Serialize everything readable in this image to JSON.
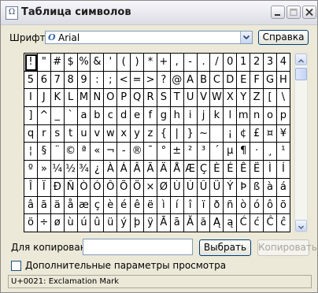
{
  "window": {
    "title": "Таблица символов"
  },
  "font_row": {
    "label": "Шрифт:",
    "selected_font": "Arial",
    "font_icon": "O",
    "help_button": "Справка"
  },
  "char_grid": {
    "selected_index": 0,
    "rows": [
      [
        "!",
        "\"",
        "#",
        "$",
        "%",
        "&",
        "'",
        "(",
        ")",
        "*",
        "+",
        ",",
        "-",
        ".",
        "/",
        "0",
        "1",
        "2",
        "3",
        "4"
      ],
      [
        "5",
        "6",
        "7",
        "8",
        "9",
        ":",
        ";",
        "<",
        "=",
        ">",
        "?",
        "@",
        "A",
        "B",
        "C",
        "D",
        "E",
        "F",
        "G",
        "H"
      ],
      [
        "I",
        "J",
        "K",
        "L",
        "M",
        "N",
        "O",
        "P",
        "Q",
        "R",
        "S",
        "T",
        "U",
        "V",
        "W",
        "X",
        "Y",
        "Z",
        "[",
        "\\"
      ],
      [
        "]",
        "^",
        "_",
        "`",
        "a",
        "b",
        "c",
        "d",
        "e",
        "f",
        "g",
        "h",
        "i",
        "j",
        "k",
        "l",
        "m",
        "n",
        "o",
        "p"
      ],
      [
        "q",
        "r",
        "s",
        "t",
        "u",
        "v",
        "w",
        "x",
        "y",
        "z",
        "{",
        "|",
        "}",
        "~",
        " ",
        "¡",
        "¢",
        "£",
        "¤",
        "¥"
      ],
      [
        "¦",
        "§",
        "¨",
        "©",
        "ª",
        "«",
        "¬",
        "-",
        "®",
        "¯",
        "°",
        "±",
        "²",
        "³",
        "´",
        "µ",
        "¶",
        "·",
        "¸",
        "¹"
      ],
      [
        "º",
        "»",
        "¼",
        "½",
        "¾",
        "¿",
        "À",
        "Á",
        "Â",
        "Ã",
        "Ä",
        "Å",
        "Æ",
        "Ç",
        "È",
        "É",
        "Ê",
        "Ë",
        "Ì",
        "Í"
      ],
      [
        "Î",
        "Ï",
        "Ð",
        "Ñ",
        "Ò",
        "Ó",
        "Ô",
        "Õ",
        "Ö",
        "×",
        "Ø",
        "Ù",
        "Ú",
        "Û",
        "Ü",
        "Ý",
        "Þ",
        "ß",
        "à",
        "á"
      ],
      [
        "â",
        "ã",
        "ä",
        "å",
        "æ",
        "ç",
        "è",
        "é",
        "ê",
        "ë",
        "ì",
        "í",
        "î",
        "ï",
        "ð",
        "ñ",
        "ò",
        "ó",
        "ô",
        "õ"
      ],
      [
        "ö",
        "÷",
        "ø",
        "ù",
        "ú",
        "û",
        "ü",
        "ý",
        "þ",
        "ÿ",
        "Ā",
        "ā",
        "Ă",
        "ă",
        "Ą",
        "ą",
        "Ć",
        "ć",
        "Ĉ",
        "ĉ"
      ]
    ]
  },
  "copy_row": {
    "label": "Для копирования:",
    "value": "",
    "select_button": "Выбрать",
    "copy_button": "Копировать"
  },
  "advanced": {
    "label": "Дополнительные параметры просмотра",
    "checked": false
  },
  "status_bar": {
    "text": "U+0021: Exclamation Mark"
  },
  "colors": {
    "accent": "#003c74",
    "window_bg": "#ECE9D8"
  }
}
